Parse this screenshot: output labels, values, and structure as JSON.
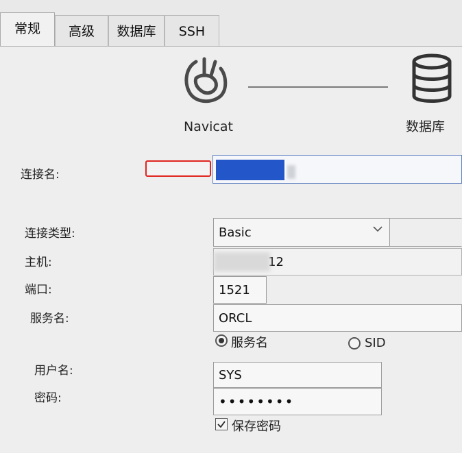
{
  "tabs": [
    {
      "label": "常规",
      "active": true
    },
    {
      "label": "高级",
      "active": false
    },
    {
      "label": "数据库",
      "active": false
    },
    {
      "label": "SSH",
      "active": false
    }
  ],
  "logos": {
    "left_label": "Navicat",
    "right_label": "数据库",
    "left_icon": "navicat-logo-icon",
    "right_icon": "database-icon"
  },
  "form": {
    "connection_name_label": "连接名:",
    "connection_type_label": "连接类型:",
    "connection_type_value": "Basic",
    "host_label": "主机:",
    "host_value_visible": "12",
    "port_label": "端口:",
    "port_value": "1521",
    "service_name_label": "服务名:",
    "service_name_value": "ORCL",
    "radio_service_name": "服务名",
    "radio_sid": "SID",
    "radio_selected": "服务名",
    "username_label": "用户名:",
    "username_value": "SYS",
    "password_label": "密码:",
    "password_value": "••••••••",
    "save_password_label": "保存密码",
    "save_password_checked": true
  },
  "colors": {
    "highlight_box": "#e0251f",
    "selection": "#2356c9"
  }
}
